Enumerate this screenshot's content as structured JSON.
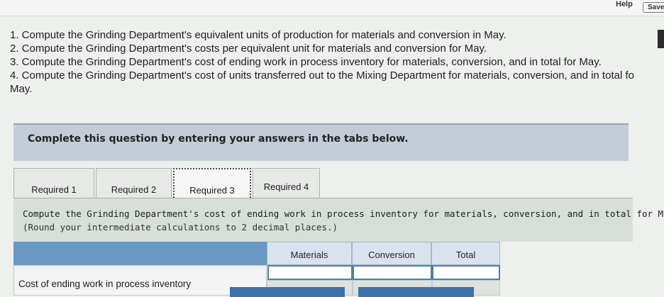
{
  "topbar": {
    "help_label": "Help",
    "save_label": "Save"
  },
  "instructions": [
    {
      "num": "1. Compute the Grinding Department's equivalent units of production for materials and conversion in May."
    },
    {
      "num": "2. Compute the Grinding Department's costs per equivalent unit for materials and conversion for May."
    },
    {
      "num": "3. Compute the Grinding Department's cost of ending work in process inventory for materials, conversion, and in total for May."
    },
    {
      "num": "4. Compute the Grinding Department's cost of units transferred out to the Mixing Department for materials, conversion, and in total fo"
    },
    {
      "num": "May."
    }
  ],
  "panel": {
    "title": "Complete this question by entering your answers in the tabs below."
  },
  "tabs": [
    {
      "label": "Required 1",
      "active": false
    },
    {
      "label": "Required 2",
      "active": false
    },
    {
      "label": "Required 3",
      "active": true
    },
    {
      "label": "Required 4",
      "active": false
    }
  ],
  "prompt": {
    "line1": "Compute the Grinding Department's cost of ending work in process inventory for materials, conversion, and in total for May.",
    "line2": "(Round your intermediate calculations to 2 decimal places.)"
  },
  "table": {
    "columns": [
      "Materials",
      "Conversion",
      "Total"
    ],
    "rows": [
      {
        "label": "Cost of ending work in process inventory",
        "materials": "",
        "conversion": "",
        "total": ""
      }
    ]
  },
  "colors": {
    "accent": "#6a98c5",
    "panel": "#c3ccd7",
    "content": "#d7dfd8",
    "button": "#3a73ad"
  }
}
